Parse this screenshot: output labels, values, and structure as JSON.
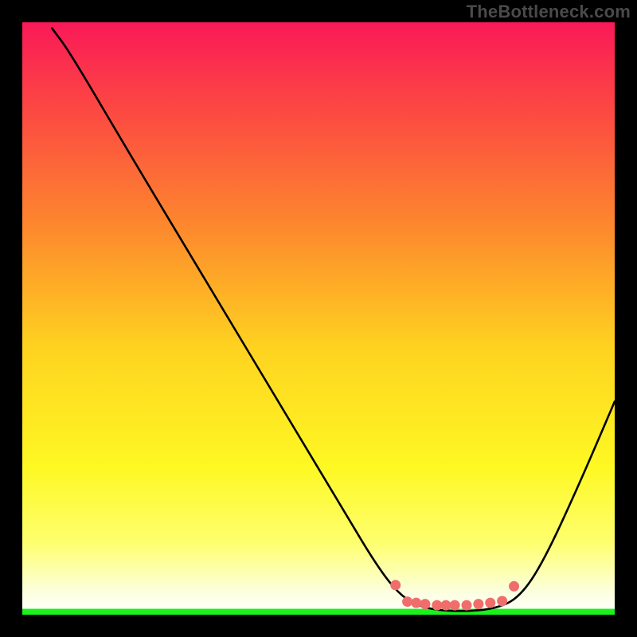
{
  "watermark": "TheBottleneck.com",
  "chart_data": {
    "type": "line",
    "title": "",
    "xlabel": "",
    "ylabel": "",
    "xlim": [
      0,
      100
    ],
    "ylim": [
      0,
      100
    ],
    "grid": false,
    "legend": false,
    "curve_points": [
      {
        "x": 5,
        "y": 99
      },
      {
        "x": 8,
        "y": 95
      },
      {
        "x": 18,
        "y": 78
      },
      {
        "x": 30,
        "y": 58
      },
      {
        "x": 42,
        "y": 38
      },
      {
        "x": 54,
        "y": 18
      },
      {
        "x": 60,
        "y": 8
      },
      {
        "x": 64,
        "y": 3
      },
      {
        "x": 68,
        "y": 1
      },
      {
        "x": 74,
        "y": 0.5
      },
      {
        "x": 80,
        "y": 1
      },
      {
        "x": 84,
        "y": 3
      },
      {
        "x": 88,
        "y": 9
      },
      {
        "x": 94,
        "y": 22
      },
      {
        "x": 100,
        "y": 36
      }
    ],
    "markers": [
      {
        "x": 63,
        "y": 5.0
      },
      {
        "x": 65,
        "y": 2.2
      },
      {
        "x": 66.5,
        "y": 2.0
      },
      {
        "x": 68,
        "y": 1.8
      },
      {
        "x": 70,
        "y": 1.6
      },
      {
        "x": 71.5,
        "y": 1.6
      },
      {
        "x": 73,
        "y": 1.6
      },
      {
        "x": 75,
        "y": 1.6
      },
      {
        "x": 77,
        "y": 1.8
      },
      {
        "x": 79,
        "y": 2.0
      },
      {
        "x": 81,
        "y": 2.3
      },
      {
        "x": 83,
        "y": 4.8
      }
    ],
    "green_band": {
      "y0": 0,
      "y1": 1
    },
    "gradient_stops": [
      {
        "y": 100,
        "color": "#fa1958"
      },
      {
        "y": 85,
        "color": "#fc4942"
      },
      {
        "y": 65,
        "color": "#fd8a2d"
      },
      {
        "y": 45,
        "color": "#fed320"
      },
      {
        "y": 25,
        "color": "#fef823"
      },
      {
        "y": 12,
        "color": "#feff70"
      },
      {
        "y": 4,
        "color": "#fcffdc"
      },
      {
        "y": 0,
        "color": "#ffffff"
      }
    ]
  }
}
